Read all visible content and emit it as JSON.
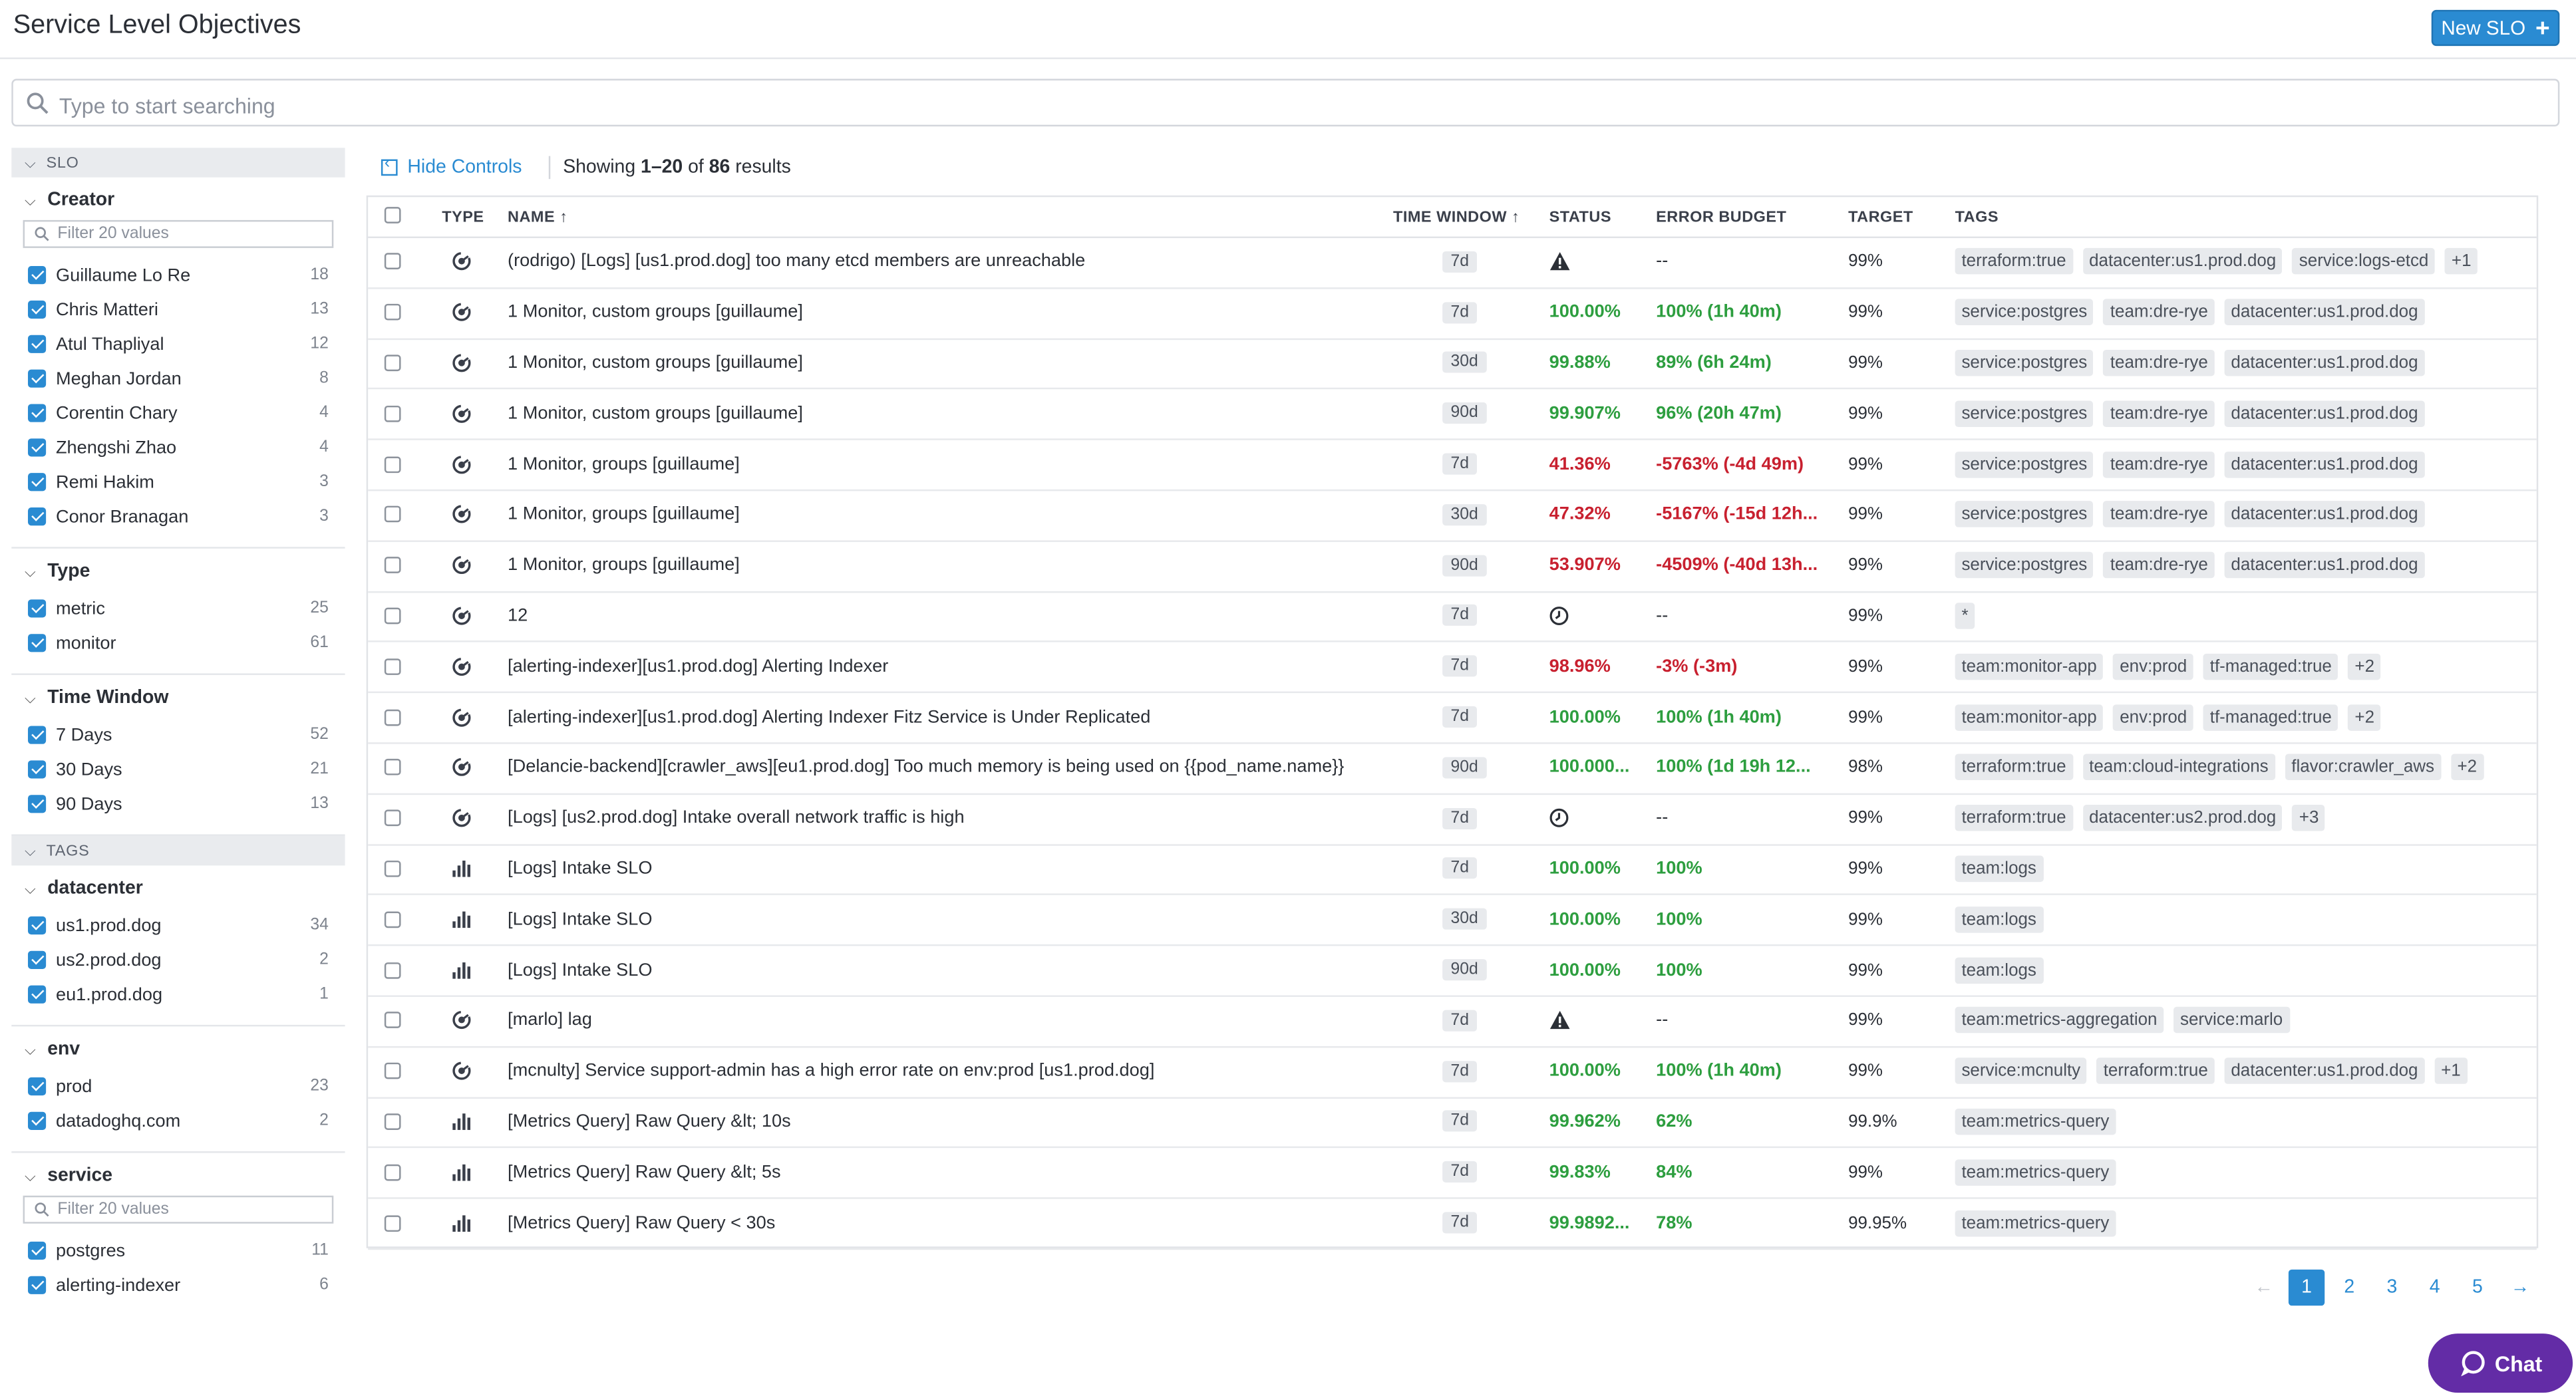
{
  "page": {
    "title": "Service Level Objectives",
    "new_button": "New SLO"
  },
  "search": {
    "placeholder": "Type to start searching"
  },
  "sidebar": {
    "slo_header": "SLO",
    "tags_header": "TAGS",
    "creator": {
      "title": "Creator",
      "filter_placeholder": "Filter 20 values",
      "options": [
        {
          "label": "Guillaume Lo Re",
          "count": "18"
        },
        {
          "label": "Chris Matteri",
          "count": "13"
        },
        {
          "label": "Atul Thapliyal",
          "count": "12"
        },
        {
          "label": "Meghan Jordan",
          "count": "8"
        },
        {
          "label": "Corentin Chary",
          "count": "4"
        },
        {
          "label": "Zhengshi Zhao",
          "count": "4"
        },
        {
          "label": "Remi Hakim",
          "count": "3"
        },
        {
          "label": "Conor Branagan",
          "count": "3"
        }
      ]
    },
    "type": {
      "title": "Type",
      "options": [
        {
          "label": "metric",
          "count": "25"
        },
        {
          "label": "monitor",
          "count": "61"
        }
      ]
    },
    "time_window": {
      "title": "Time Window",
      "options": [
        {
          "label": "7 Days",
          "count": "52"
        },
        {
          "label": "30 Days",
          "count": "21"
        },
        {
          "label": "90 Days",
          "count": "13"
        }
      ]
    },
    "datacenter": {
      "title": "datacenter",
      "options": [
        {
          "label": "us1.prod.dog",
          "count": "34"
        },
        {
          "label": "us2.prod.dog",
          "count": "2"
        },
        {
          "label": "eu1.prod.dog",
          "count": "1"
        }
      ]
    },
    "env": {
      "title": "env",
      "options": [
        {
          "label": "prod",
          "count": "23"
        },
        {
          "label": "datadoghq.com",
          "count": "2"
        }
      ]
    },
    "service": {
      "title": "service",
      "filter_placeholder": "Filter 20 values",
      "options": [
        {
          "label": "postgres",
          "count": "11"
        },
        {
          "label": "alerting-indexer",
          "count": "6"
        }
      ]
    }
  },
  "controls": {
    "hide_label": "Hide Controls",
    "showing_prefix": "Showing ",
    "range": "1–20",
    "of": " of ",
    "total": "86",
    "suffix": " results"
  },
  "table": {
    "headers": {
      "type": "TYPE",
      "name": "NAME ↑",
      "time_window": "TIME WINDOW ↑",
      "status": "STATUS",
      "error_budget": "ERROR BUDGET",
      "target": "TARGET",
      "tags": "TAGS"
    },
    "rows": [
      {
        "type": "monitor",
        "name": "(rodrigo) [Logs] [us1.prod.dog] too many etcd members are unreachable",
        "window": "7d",
        "status": "",
        "status_icon": "warning-icon",
        "status_color": "none",
        "budget": "--",
        "budget_color": "none",
        "target": "99%",
        "tags": [
          "terraform:true",
          "datacenter:us1.prod.dog",
          "service:logs-etcd",
          "+1"
        ]
      },
      {
        "type": "monitor",
        "name": "1 Monitor, custom groups [guillaume]",
        "window": "7d",
        "status": "100.00%",
        "status_color": "green",
        "budget": "100% (1h 40m)",
        "budget_color": "green",
        "target": "99%",
        "tags": [
          "service:postgres",
          "team:dre-rye",
          "datacenter:us1.prod.dog"
        ]
      },
      {
        "type": "monitor",
        "name": "1 Monitor, custom groups [guillaume]",
        "window": "30d",
        "status": "99.88%",
        "status_color": "green",
        "budget": "89% (6h 24m)",
        "budget_color": "green",
        "target": "99%",
        "tags": [
          "service:postgres",
          "team:dre-rye",
          "datacenter:us1.prod.dog"
        ]
      },
      {
        "type": "monitor",
        "name": "1 Monitor, custom groups [guillaume]",
        "window": "90d",
        "status": "99.907%",
        "status_color": "green",
        "budget": "96% (20h 47m)",
        "budget_color": "green",
        "target": "99%",
        "tags": [
          "service:postgres",
          "team:dre-rye",
          "datacenter:us1.prod.dog"
        ]
      },
      {
        "type": "monitor",
        "name": "1 Monitor, groups [guillaume]",
        "window": "7d",
        "status": "41.36%",
        "status_color": "red",
        "budget": "-5763% (-4d 49m)",
        "budget_color": "red",
        "target": "99%",
        "tags": [
          "service:postgres",
          "team:dre-rye",
          "datacenter:us1.prod.dog"
        ]
      },
      {
        "type": "monitor",
        "name": "1 Monitor, groups [guillaume]",
        "window": "30d",
        "status": "47.32%",
        "status_color": "red",
        "budget": "-5167% (-15d 12h...",
        "budget_color": "red",
        "target": "99%",
        "tags": [
          "service:postgres",
          "team:dre-rye",
          "datacenter:us1.prod.dog"
        ]
      },
      {
        "type": "monitor",
        "name": "1 Monitor, groups [guillaume]",
        "window": "90d",
        "status": "53.907%",
        "status_color": "red",
        "budget": "-4509% (-40d 13h...",
        "budget_color": "red",
        "target": "99%",
        "tags": [
          "service:postgres",
          "team:dre-rye",
          "datacenter:us1.prod.dog"
        ]
      },
      {
        "type": "monitor",
        "name": "12",
        "window": "7d",
        "status": "",
        "status_icon": "clock-icon",
        "status_color": "none",
        "budget": "--",
        "budget_color": "none",
        "target": "99%",
        "tags": [
          "*"
        ]
      },
      {
        "type": "monitor",
        "name": "[alerting-indexer][us1.prod.dog] Alerting Indexer",
        "window": "7d",
        "status": "98.96%",
        "status_color": "red",
        "budget": "-3% (-3m)",
        "budget_color": "red",
        "target": "99%",
        "tags": [
          "team:monitor-app",
          "env:prod",
          "tf-managed:true",
          "+2"
        ]
      },
      {
        "type": "monitor",
        "name": "[alerting-indexer][us1.prod.dog] Alerting Indexer Fitz Service is Under Replicated",
        "window": "7d",
        "status": "100.00%",
        "status_color": "green",
        "budget": "100% (1h 40m)",
        "budget_color": "green",
        "target": "99%",
        "tags": [
          "team:monitor-app",
          "env:prod",
          "tf-managed:true",
          "+2"
        ]
      },
      {
        "type": "monitor",
        "name": "[Delancie-backend][crawler_aws][eu1.prod.dog] Too much memory is being used on {{pod_name.name}}",
        "window": "90d",
        "status": "100.000...",
        "status_color": "green",
        "budget": "100% (1d 19h 12...",
        "budget_color": "green",
        "target": "98%",
        "tags": [
          "terraform:true",
          "team:cloud-integrations",
          "flavor:crawler_aws",
          "+2"
        ]
      },
      {
        "type": "monitor",
        "name": "[Logs] [us2.prod.dog] Intake overall network traffic is high",
        "window": "7d",
        "status": "",
        "status_icon": "clock-icon",
        "status_color": "none",
        "budget": "--",
        "budget_color": "none",
        "target": "99%",
        "tags": [
          "terraform:true",
          "datacenter:us2.prod.dog",
          "+3"
        ]
      },
      {
        "type": "metric",
        "name": "[Logs] Intake SLO",
        "window": "7d",
        "status": "100.00%",
        "status_color": "green",
        "budget": "100%",
        "budget_color": "green",
        "target": "99%",
        "tags": [
          "team:logs"
        ]
      },
      {
        "type": "metric",
        "name": "[Logs] Intake SLO",
        "window": "30d",
        "status": "100.00%",
        "status_color": "green",
        "budget": "100%",
        "budget_color": "green",
        "target": "99%",
        "tags": [
          "team:logs"
        ]
      },
      {
        "type": "metric",
        "name": "[Logs] Intake SLO",
        "window": "90d",
        "status": "100.00%",
        "status_color": "green",
        "budget": "100%",
        "budget_color": "green",
        "target": "99%",
        "tags": [
          "team:logs"
        ]
      },
      {
        "type": "monitor",
        "name": "[marlo] lag",
        "window": "7d",
        "status": "",
        "status_icon": "warning-icon",
        "status_color": "none",
        "budget": "--",
        "budget_color": "none",
        "target": "99%",
        "tags": [
          "team:metrics-aggregation",
          "service:marlo"
        ]
      },
      {
        "type": "monitor",
        "name": "[mcnulty] Service support-admin has a high error rate on env:prod [us1.prod.dog]",
        "window": "7d",
        "status": "100.00%",
        "status_color": "green",
        "budget": "100% (1h 40m)",
        "budget_color": "green",
        "target": "99%",
        "tags": [
          "service:mcnulty",
          "terraform:true",
          "datacenter:us1.prod.dog",
          "+1"
        ]
      },
      {
        "type": "metric",
        "name": "[Metrics Query] Raw Query &lt; 10s",
        "window": "7d",
        "status": "99.962%",
        "status_color": "green",
        "budget": "62%",
        "budget_color": "green",
        "target": "99.9%",
        "tags": [
          "team:metrics-query"
        ]
      },
      {
        "type": "metric",
        "name": "[Metrics Query] Raw Query &lt; 5s",
        "window": "7d",
        "status": "99.83%",
        "status_color": "green",
        "budget": "84%",
        "budget_color": "green",
        "target": "99%",
        "tags": [
          "team:metrics-query"
        ]
      },
      {
        "type": "metric",
        "name": "[Metrics Query] Raw Query < 30s",
        "window": "7d",
        "status": "99.9892...",
        "status_color": "green",
        "budget": "78%",
        "budget_color": "green",
        "target": "99.95%",
        "tags": [
          "team:metrics-query"
        ]
      }
    ]
  },
  "pagination": {
    "prev": "←",
    "pages": [
      "1",
      "2",
      "3",
      "4",
      "5"
    ],
    "active": "1",
    "next": "→"
  },
  "chat": {
    "label": "Chat"
  },
  "colors": {
    "accent": "#2a8bd2",
    "green": "#2d9e3f",
    "red": "#c8202f",
    "chat": "#632ca6"
  }
}
